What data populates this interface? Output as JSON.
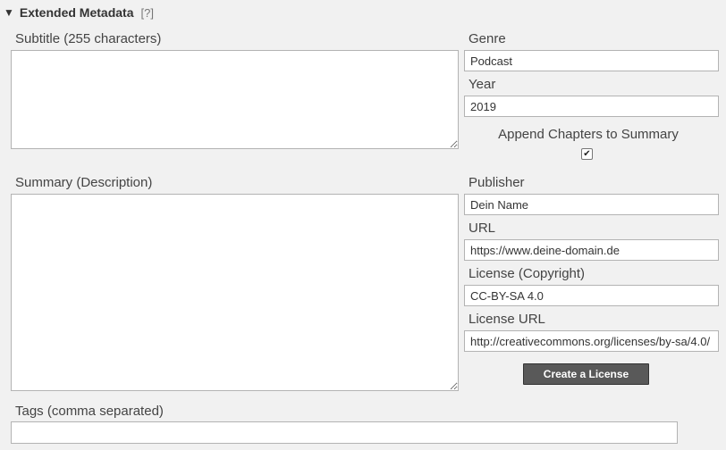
{
  "section": {
    "toggle_icon": "▼",
    "title": "Extended Metadata",
    "help": "[?]"
  },
  "fields": {
    "subtitle": {
      "label": "Subtitle (255 characters)",
      "value": ""
    },
    "summary": {
      "label": "Summary (Description)",
      "value": ""
    },
    "tags": {
      "label": "Tags (comma separated)",
      "value": ""
    },
    "genre": {
      "label": "Genre",
      "value": "Podcast"
    },
    "year": {
      "label": "Year",
      "value": "2019"
    },
    "append_chapters": {
      "label": "Append Chapters to Summary",
      "checked": true,
      "check_glyph": "✔"
    },
    "publisher": {
      "label": "Publisher",
      "value": "Dein Name"
    },
    "url": {
      "label": "URL",
      "value": "https://www.deine-domain.de"
    },
    "license": {
      "label": "License (Copyright)",
      "value": "CC-BY-SA 4.0"
    },
    "license_url": {
      "label": "License URL",
      "value": "http://creativecommons.org/licenses/by-sa/4.0/"
    }
  },
  "buttons": {
    "create_license": "Create a License"
  }
}
